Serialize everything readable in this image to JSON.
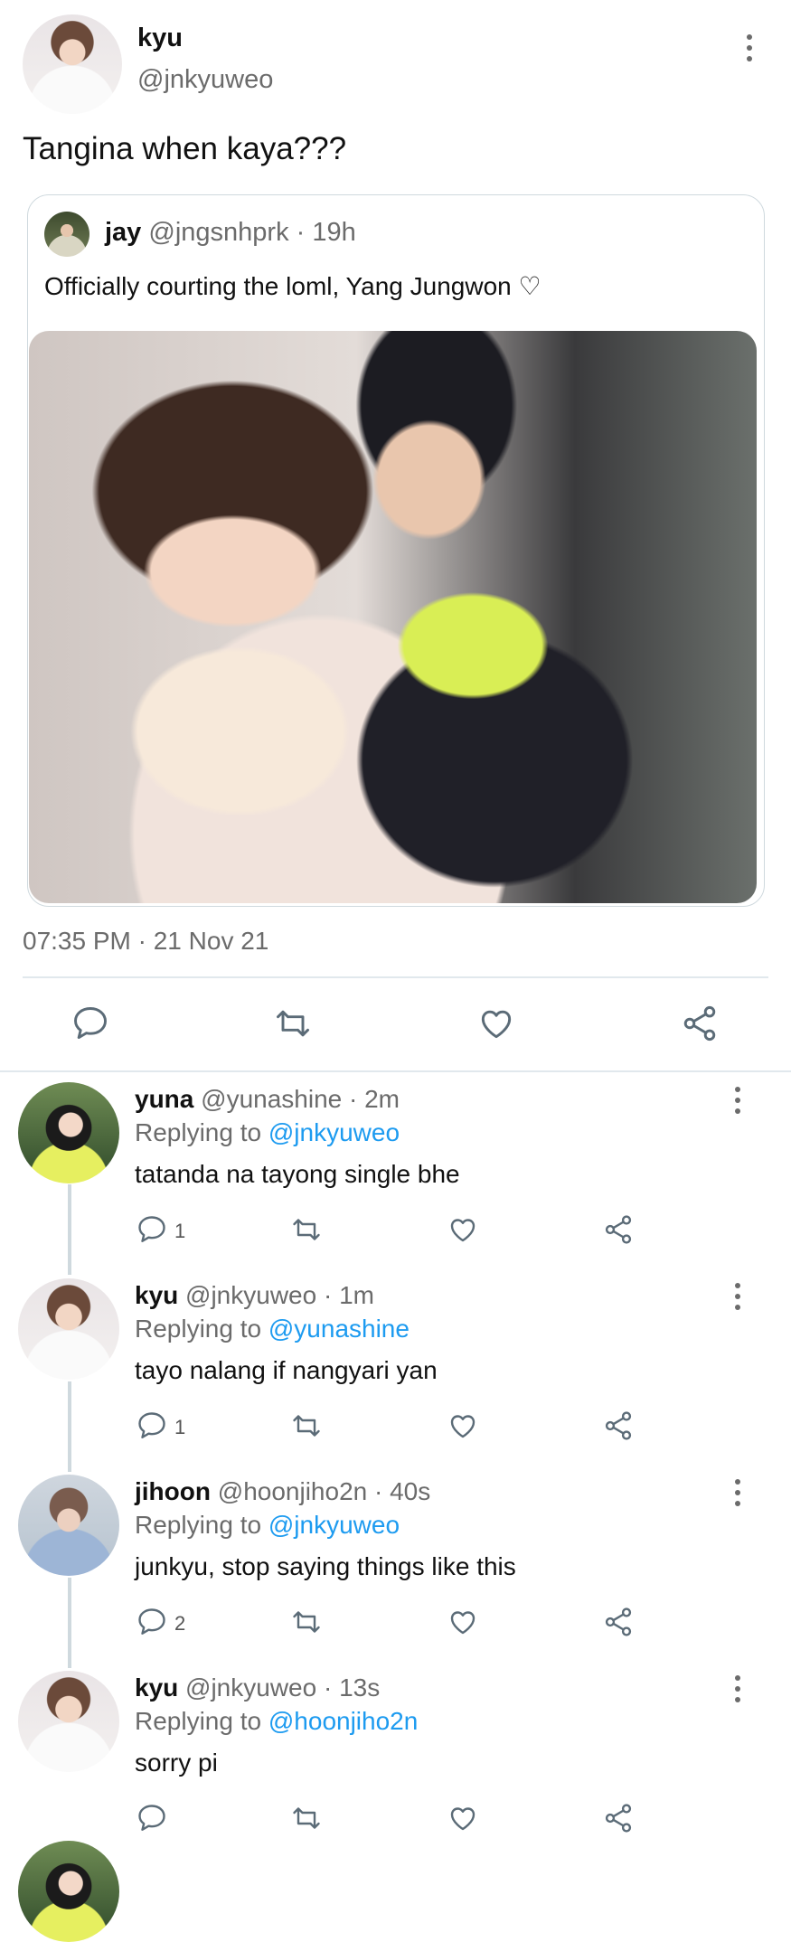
{
  "tweet": {
    "author_name": "kyu",
    "author_handle": "@jnkyuweo",
    "text": "Tangina when kaya???",
    "timestamp": "07:35 PM · 21 Nov 21",
    "avatar_icon": "profile-photo"
  },
  "quoted": {
    "author_name": "jay",
    "author_handle": "@jngsnhprk",
    "time": "· 19h",
    "text": "Officially courting the loml, Yang Jungwon ♡",
    "media": "photo"
  },
  "actions": [
    "reply-icon",
    "retweet-icon",
    "like-icon",
    "share-icon"
  ],
  "replies": [
    {
      "name": "yuna",
      "handle": "@yunashine",
      "time": "· 2m",
      "replying_label": "Replying to",
      "replying_to": "@jnkyuweo",
      "text": "tatanda na tayong single bhe",
      "reply_count": "1"
    },
    {
      "name": "kyu",
      "handle": "@jnkyuweo",
      "time": "· 1m",
      "replying_label": "Replying to",
      "replying_to": "@yunashine",
      "text": "tayo nalang if nangyari yan",
      "reply_count": "1"
    },
    {
      "name": "jihoon",
      "handle": "@hoonjiho2n",
      "time": "· 40s",
      "replying_label": "Replying to",
      "replying_to": "@jnkyuweo",
      "text": "junkyu, stop saying things like this",
      "reply_count": "2"
    },
    {
      "name": "kyu",
      "handle": "@jnkyuweo",
      "time": "· 13s",
      "replying_label": "Replying to",
      "replying_to": "@hoonjiho2n",
      "text": "sorry pi",
      "reply_count": ""
    }
  ],
  "colors": {
    "link": "#1d9bf0",
    "muted": "#6b6b6b",
    "divider": "#e1e8ed"
  }
}
